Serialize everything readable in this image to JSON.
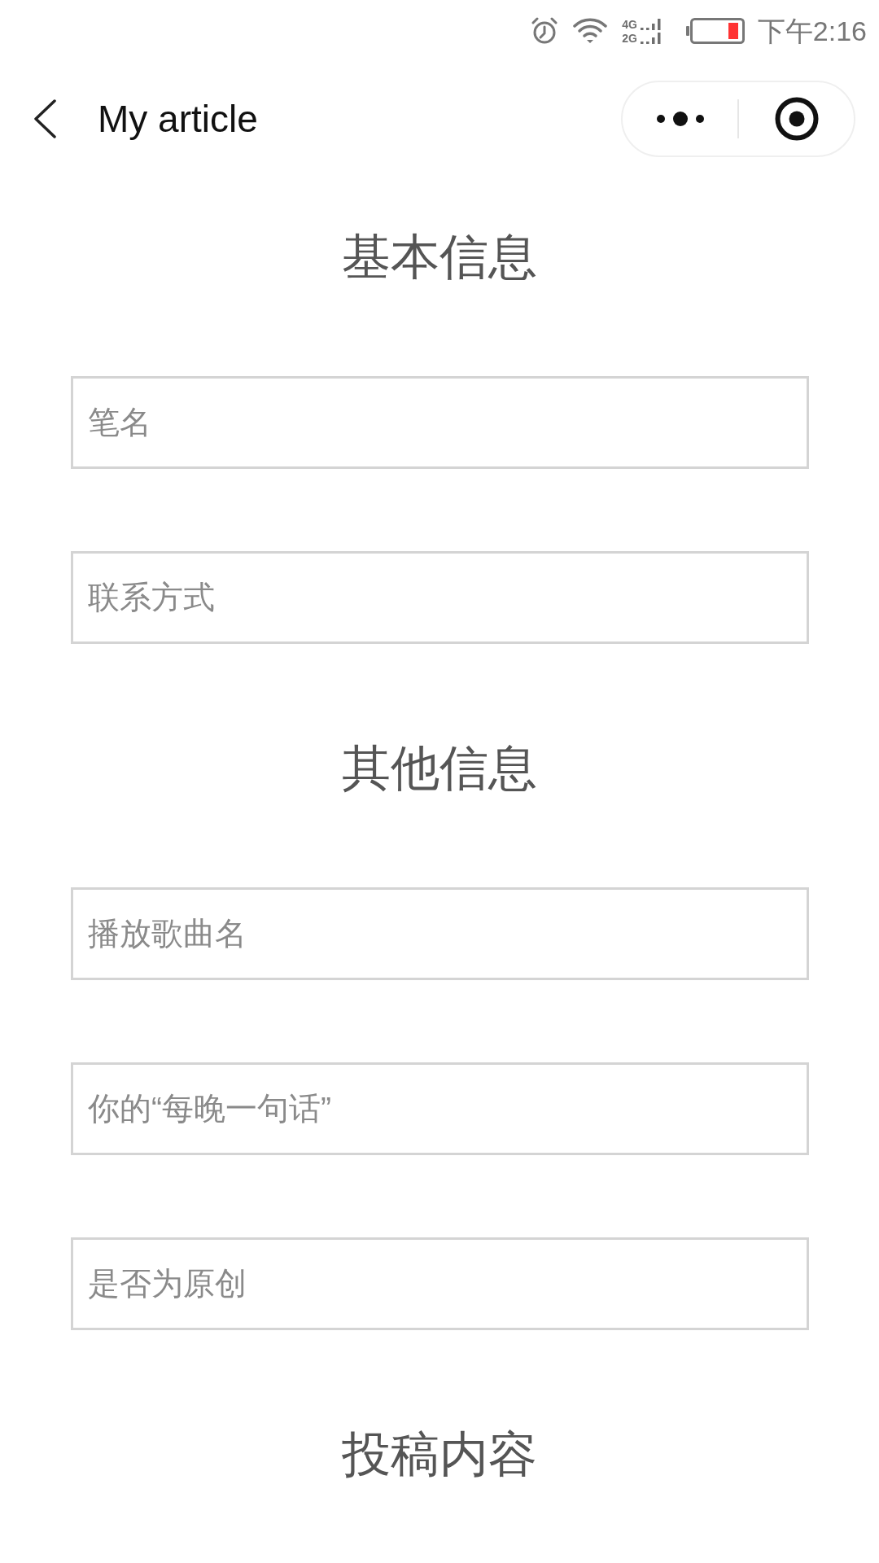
{
  "status_bar": {
    "network": [
      "4G",
      "2G"
    ],
    "time": "下午2:16"
  },
  "nav_bar": {
    "title": "My article"
  },
  "sections": [
    {
      "title": "基本信息",
      "fields": [
        {
          "placeholder": "笔名"
        },
        {
          "placeholder": "联系方式"
        }
      ]
    },
    {
      "title": "其他信息",
      "fields": [
        {
          "placeholder": "播放歌曲名"
        },
        {
          "placeholder": "你的“每晚一句话”"
        },
        {
          "placeholder": "是否为原创"
        }
      ]
    },
    {
      "title": "投稿内容"
    }
  ]
}
